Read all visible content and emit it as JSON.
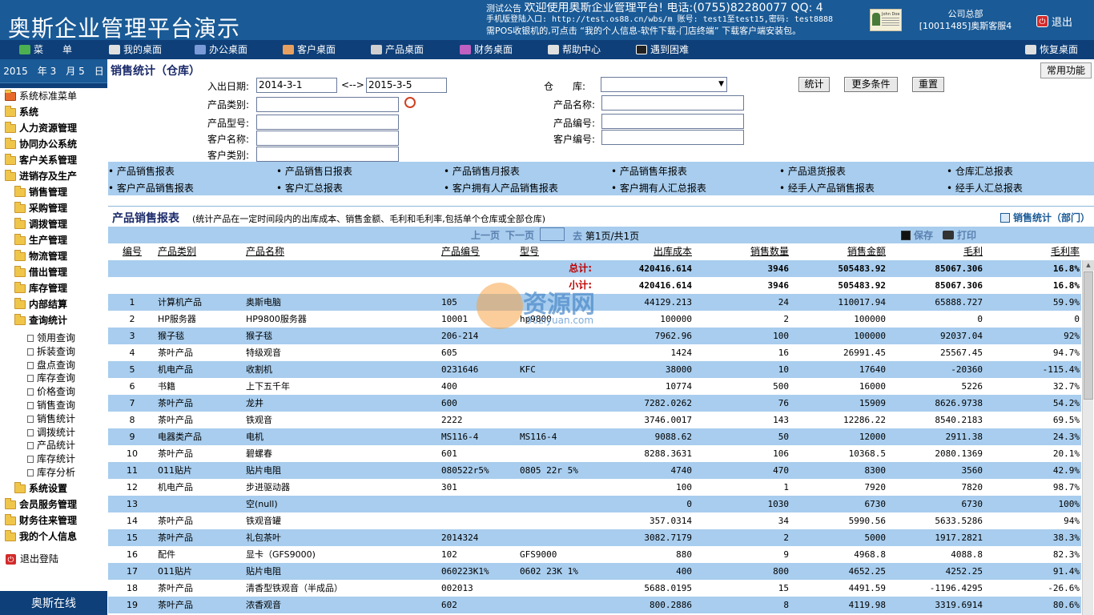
{
  "app": {
    "title": "奥斯企业管理平台演示"
  },
  "header": {
    "notice_prefix": "测试公告",
    "notice_main": "欢迎使用奥斯企业管理平台! 电话:(0755)82280077 QQ: 4",
    "notice_line2": "手机版登陆入口: http://test.os88.cn/wbs/m 账号: test1至test15,密码: test8888",
    "notice_line3": "需POS收银机的,可点击 “我的个人信息-软件下载-门店终端” 下载客户端安装包。",
    "avatar_name": "John Doe",
    "company_name": "公司总部",
    "user": "[10011485]奥斯客服4",
    "logout": "退出"
  },
  "menubar": {
    "items": [
      {
        "label": "菜　　单",
        "icon": "menu-arrow-icon",
        "color": "#4caf50"
      },
      {
        "label": "我的桌面",
        "icon": "desktop-icon",
        "color": "#e0e0e0"
      },
      {
        "label": "办公桌面",
        "icon": "office-chart-icon",
        "color": "#7a9ad8"
      },
      {
        "label": "客户桌面",
        "icon": "customers-icon",
        "color": "#e8a060"
      },
      {
        "label": "产品桌面",
        "icon": "cart-icon",
        "color": "#d0d0d0"
      },
      {
        "label": "财务桌面",
        "icon": "finance-chart-icon",
        "color": "#c060c0"
      },
      {
        "label": "帮助中心",
        "icon": "book-icon",
        "color": "#e0e0e0"
      },
      {
        "label": "遇到困难",
        "icon": "penguin-icon",
        "color": "#222222"
      },
      {
        "label": "恢复桌面",
        "icon": "restore-icon",
        "color": "#e0e0e0"
      }
    ]
  },
  "sidebar": {
    "date": "2015　年 3　月 5　日",
    "tree": [
      {
        "label": "系统标准菜单",
        "type": "home",
        "level": 0,
        "bold": false
      },
      {
        "label": "系统",
        "type": "folder",
        "level": 0,
        "bold": true
      },
      {
        "label": "人力资源管理",
        "type": "folder",
        "level": 0,
        "bold": true
      },
      {
        "label": "协同办公系统",
        "type": "folder",
        "level": 0,
        "bold": true
      },
      {
        "label": "客户关系管理",
        "type": "folder",
        "level": 0,
        "bold": true
      },
      {
        "label": "进销存及生产",
        "type": "folder-open",
        "level": 0,
        "bold": true
      },
      {
        "label": "销售管理",
        "type": "folder",
        "level": 1,
        "bold": true
      },
      {
        "label": "采购管理",
        "type": "folder",
        "level": 1,
        "bold": true
      },
      {
        "label": "调拨管理",
        "type": "folder",
        "level": 1,
        "bold": true
      },
      {
        "label": "生产管理",
        "type": "folder",
        "level": 1,
        "bold": true
      },
      {
        "label": "物流管理",
        "type": "folder",
        "level": 1,
        "bold": true
      },
      {
        "label": "借出管理",
        "type": "folder",
        "level": 1,
        "bold": true
      },
      {
        "label": "库存管理",
        "type": "folder",
        "level": 1,
        "bold": true
      },
      {
        "label": "内部结算",
        "type": "folder",
        "level": 1,
        "bold": true
      },
      {
        "label": "查询统计",
        "type": "folder-open",
        "level": 1,
        "bold": true
      },
      {
        "label": "领用查询",
        "type": "doc",
        "level": 2,
        "bold": false
      },
      {
        "label": "拆装查询",
        "type": "doc",
        "level": 2,
        "bold": false
      },
      {
        "label": "盘点查询",
        "type": "doc",
        "level": 2,
        "bold": false
      },
      {
        "label": "库存查询",
        "type": "doc",
        "level": 2,
        "bold": false
      },
      {
        "label": "价格查询",
        "type": "doc",
        "level": 2,
        "bold": false
      },
      {
        "label": "销售查询",
        "type": "doc",
        "level": 2,
        "bold": false
      },
      {
        "label": "销售统计",
        "type": "doc",
        "level": 2,
        "bold": false
      },
      {
        "label": "调拨统计",
        "type": "doc",
        "level": 2,
        "bold": false
      },
      {
        "label": "产品统计",
        "type": "doc",
        "level": 2,
        "bold": false
      },
      {
        "label": "库存统计",
        "type": "doc",
        "level": 2,
        "bold": false
      },
      {
        "label": "库存分析",
        "type": "doc",
        "level": 2,
        "bold": false
      },
      {
        "label": "系统设置",
        "type": "folder",
        "level": 1,
        "bold": true
      },
      {
        "label": "会员服务管理",
        "type": "folder",
        "level": 0,
        "bold": true
      },
      {
        "label": "财务往来管理",
        "type": "folder",
        "level": 0,
        "bold": true
      },
      {
        "label": "我的个人信息",
        "type": "folder",
        "level": 0,
        "bold": true
      },
      {
        "label": "退出登陆",
        "type": "logout",
        "level": 0,
        "bold": false
      }
    ],
    "footer": "奥斯在线"
  },
  "main": {
    "page_title": "销售统计（仓库）",
    "common_functions": "常用功能",
    "filters": {
      "date_label": "入出日期:",
      "date_from": "2014-3-1",
      "date_sep": "<-->",
      "date_to": "2015-3-5",
      "warehouse_label": "仓　　库:",
      "warehouse_value": "",
      "category_label": "产品类别:",
      "category_value": "",
      "product_name_label": "产品名称:",
      "product_name_value": "",
      "model_label": "产品型号:",
      "model_value": "",
      "product_code_label": "产品编号:",
      "product_code_value": "",
      "customer_name_label": "客户名称:",
      "customer_name_value": "",
      "customer_code_label": "客户编号:",
      "customer_code_value": "",
      "customer_type_label": "客户类别:",
      "customer_type_value": "",
      "btn_stats": "统计",
      "btn_more": "更多条件",
      "btn_reset": "重置"
    },
    "report_links": [
      "产品销售报表",
      "产品销售日报表",
      "产品销售月报表",
      "产品销售年报表",
      "产品退货报表",
      "仓库汇总报表",
      "客户产品销售报表",
      "客户汇总报表",
      "客户拥有人产品销售报表",
      "客户拥有人汇总报表",
      "经手人产品销售报表",
      "经手人汇总报表"
    ],
    "report": {
      "title": "产品销售报表",
      "description": "(统计产品在一定时间段内的出库成本、销售金额、毛利和毛利率,包括单个仓库或全部仓库)",
      "side_link": "销售统计（部门）"
    },
    "pager": {
      "prev": "上一页",
      "next": "下一页",
      "page_input": "",
      "go": "去",
      "info": "第1页/共1页",
      "save": "保存",
      "print": "打印"
    },
    "table": {
      "columns": [
        "编号",
        "产品类别",
        "产品名称",
        "产品编号",
        "型号",
        "出库成本",
        "销售数量",
        "销售金额",
        "毛利",
        "毛利率"
      ],
      "total": {
        "label": "总计:",
        "cost": "420416.614",
        "qty": "3946",
        "amount": "505483.92",
        "profit": "85067.306",
        "rate": "16.8%"
      },
      "subtotal": {
        "label": "小计:",
        "cost": "420416.614",
        "qty": "3946",
        "amount": "505483.92",
        "profit": "85067.306",
        "rate": "16.8%"
      },
      "rows": [
        {
          "no": "1",
          "cat": "计算机产品",
          "name": "奥斯电脑",
          "code": "105",
          "model": "",
          "cost": "44129.213",
          "qty": "24",
          "amount": "110017.94",
          "profit": "65888.727",
          "rate": "59.9%"
        },
        {
          "no": "2",
          "cat": "HP服务器",
          "name": "HP9800服务器",
          "code": "10001",
          "model": "hp9800",
          "cost": "100000",
          "qty": "2",
          "amount": "100000",
          "profit": "0",
          "rate": "0"
        },
        {
          "no": "3",
          "cat": "猴子毯",
          "name": "猴子毯",
          "code": "206-214",
          "model": "",
          "cost": "7962.96",
          "qty": "100",
          "amount": "100000",
          "profit": "92037.04",
          "rate": "92%"
        },
        {
          "no": "4",
          "cat": "茶叶产品",
          "name": "特级观音",
          "code": "605",
          "model": "",
          "cost": "1424",
          "qty": "16",
          "amount": "26991.45",
          "profit": "25567.45",
          "rate": "94.7%"
        },
        {
          "no": "5",
          "cat": "机电产品",
          "name": "收割机",
          "code": "0231646",
          "model": "KFC",
          "cost": "38000",
          "qty": "10",
          "amount": "17640",
          "profit": "-20360",
          "rate": "-115.4%"
        },
        {
          "no": "6",
          "cat": "书籍",
          "name": "上下五千年",
          "code": "400",
          "model": "",
          "cost": "10774",
          "qty": "500",
          "amount": "16000",
          "profit": "5226",
          "rate": "32.7%"
        },
        {
          "no": "7",
          "cat": "茶叶产品",
          "name": "龙井",
          "code": "600",
          "model": "",
          "cost": "7282.0262",
          "qty": "76",
          "amount": "15909",
          "profit": "8626.9738",
          "rate": "54.2%"
        },
        {
          "no": "8",
          "cat": "茶叶产品",
          "name": "铁观音",
          "code": "2222",
          "model": "",
          "cost": "3746.0017",
          "qty": "143",
          "amount": "12286.22",
          "profit": "8540.2183",
          "rate": "69.5%"
        },
        {
          "no": "9",
          "cat": "电器类产品",
          "name": "电机",
          "code": "MS116-4",
          "model": "MS116-4",
          "cost": "9088.62",
          "qty": "50",
          "amount": "12000",
          "profit": "2911.38",
          "rate": "24.3%"
        },
        {
          "no": "10",
          "cat": "茶叶产品",
          "name": "碧螺春",
          "code": "601",
          "model": "",
          "cost": "8288.3631",
          "qty": "106",
          "amount": "10368.5",
          "profit": "2080.1369",
          "rate": "20.1%"
        },
        {
          "no": "11",
          "cat": "011贴片",
          "name": "贴片电阻",
          "code": "080522r5%",
          "model": "0805 22r 5%",
          "cost": "4740",
          "qty": "470",
          "amount": "8300",
          "profit": "3560",
          "rate": "42.9%"
        },
        {
          "no": "12",
          "cat": "机电产品",
          "name": "步进驱动器",
          "code": "301",
          "model": "",
          "cost": "100",
          "qty": "1",
          "amount": "7920",
          "profit": "7820",
          "rate": "98.7%"
        },
        {
          "no": "13",
          "cat": "",
          "name": "空(null)",
          "code": "",
          "model": "",
          "cost": "0",
          "qty": "1030",
          "amount": "6730",
          "profit": "6730",
          "rate": "100%"
        },
        {
          "no": "14",
          "cat": "茶叶产品",
          "name": "铁观音罐",
          "code": "",
          "model": "",
          "cost": "357.0314",
          "qty": "34",
          "amount": "5990.56",
          "profit": "5633.5286",
          "rate": "94%"
        },
        {
          "no": "15",
          "cat": "茶叶产品",
          "name": "礼包茶叶",
          "code": "2014324",
          "model": "",
          "cost": "3082.7179",
          "qty": "2",
          "amount": "5000",
          "profit": "1917.2821",
          "rate": "38.3%"
        },
        {
          "no": "16",
          "cat": "配件",
          "name": "显卡（GFS9000)",
          "code": "102",
          "model": "GFS9000",
          "cost": "880",
          "qty": "9",
          "amount": "4968.8",
          "profit": "4088.8",
          "rate": "82.3%"
        },
        {
          "no": "17",
          "cat": "011贴片",
          "name": "贴片电阻",
          "code": "060223K1%",
          "model": "0602 23K 1%",
          "cost": "400",
          "qty": "800",
          "amount": "4652.25",
          "profit": "4252.25",
          "rate": "91.4%"
        },
        {
          "no": "18",
          "cat": "茶叶产品",
          "name": "清香型铁观音（半成品）",
          "code": "002013",
          "model": "",
          "cost": "5688.0195",
          "qty": "15",
          "amount": "4491.59",
          "profit": "-1196.4295",
          "rate": "-26.6%"
        },
        {
          "no": "19",
          "cat": "茶叶产品",
          "name": "浓香观音",
          "code": "602",
          "model": "",
          "cost": "800.2886",
          "qty": "8",
          "amount": "4119.98",
          "profit": "3319.6914",
          "rate": "80.6%"
        }
      ]
    }
  },
  "watermark": {
    "text": "资源网",
    "url": "90ziyuan.com"
  },
  "colors": {
    "header_bg": "#1a5a96",
    "menubar_bg": "#0e3f78",
    "row_alt": "#a8cdee",
    "total_label": "#c00000"
  }
}
